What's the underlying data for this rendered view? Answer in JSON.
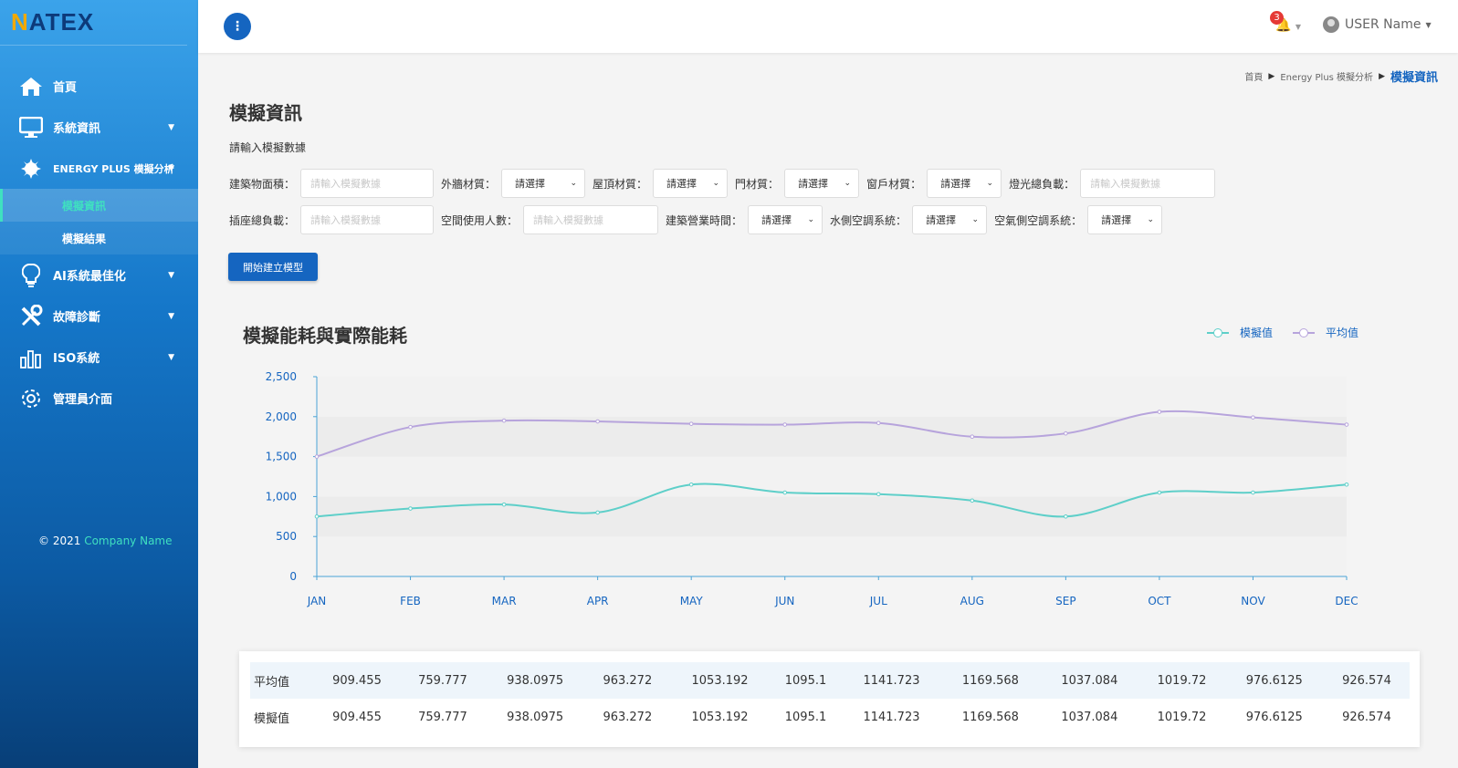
{
  "brand": {
    "logo_n": "N",
    "logo_rest": "ATEX"
  },
  "sidebar": {
    "items": [
      {
        "label": "首頁",
        "icon": "home-icon"
      },
      {
        "label": "系統資訊",
        "icon": "monitor-icon"
      },
      {
        "label": "ENERGY PLUS 模擬分析",
        "icon": "energy-icon"
      },
      {
        "label": "AI系統最佳化",
        "icon": "lightbulb-icon"
      },
      {
        "label": "故障診斷",
        "icon": "tools-icon"
      },
      {
        "label": "ISO系統",
        "icon": "bar-chart-icon"
      },
      {
        "label": "管理員介面",
        "icon": "gear-icon"
      }
    ],
    "sub_items": [
      {
        "label": "模擬資訊",
        "active": true
      },
      {
        "label": "模擬結果",
        "active": false
      }
    ],
    "copyright": "© 2021",
    "company": "Company Name"
  },
  "topbar": {
    "menu_glyph": "⋮",
    "notifications": "3",
    "user_name": "USER Name"
  },
  "breadcrumb": {
    "home": "首頁",
    "parent": "Energy Plus 模擬分析",
    "current": "模擬資訊"
  },
  "page": {
    "title": "模擬資訊",
    "hint": "請輸入模擬數據"
  },
  "form": {
    "input_placeholder": "請輸入模擬數據",
    "select_placeholder": "請選擇",
    "labels": {
      "area": "建築物面積：",
      "wall": "外牆材質：",
      "roof": "屋頂材質：",
      "door": "門材質：",
      "window": "窗戶材質：",
      "light": "燈光總負載：",
      "socket": "插座總負載：",
      "people": "空間使用人數：",
      "hours": "建築營業時間：",
      "water_ac": "水側空調系統：",
      "air_ac": "空氣側空調系統："
    },
    "submit": "開始建立模型"
  },
  "chart_data": {
    "type": "line",
    "title": "模擬能耗與實際能耗",
    "categories": [
      "JAN",
      "FEB",
      "MAR",
      "APR",
      "MAY",
      "JUN",
      "JUL",
      "AUG",
      "SEP",
      "OCT",
      "NOV",
      "DEC"
    ],
    "series": [
      {
        "name": "模擬值",
        "color": "#5ecfc9",
        "values": [
          750,
          850,
          900,
          800,
          1150,
          1050,
          1030,
          950,
          750,
          1050,
          1050,
          1150
        ]
      },
      {
        "name": "平均值",
        "color": "#b7a4dc",
        "values": [
          1500,
          1870,
          1950,
          1940,
          1910,
          1900,
          1920,
          1750,
          1790,
          2060,
          1990,
          1900
        ]
      }
    ],
    "yticks": [
      "0",
      "500",
      "1,000",
      "1,500",
      "2,000",
      "2,500"
    ],
    "ylim": [
      0,
      2500
    ],
    "legend": "top-right"
  },
  "table": {
    "rows": [
      {
        "label": "平均值",
        "values": [
          "909.455",
          "759.777",
          "938.0975",
          "963.272",
          "1053.192",
          "1095.1",
          "1141.723",
          "1169.568",
          "1037.084",
          "1019.72",
          "976.6125",
          "926.574"
        ]
      },
      {
        "label": "模擬值",
        "values": [
          "909.455",
          "759.777",
          "938.0975",
          "963.272",
          "1053.192",
          "1095.1",
          "1141.723",
          "1169.568",
          "1037.084",
          "1019.72",
          "976.6125",
          "926.574"
        ]
      }
    ]
  }
}
